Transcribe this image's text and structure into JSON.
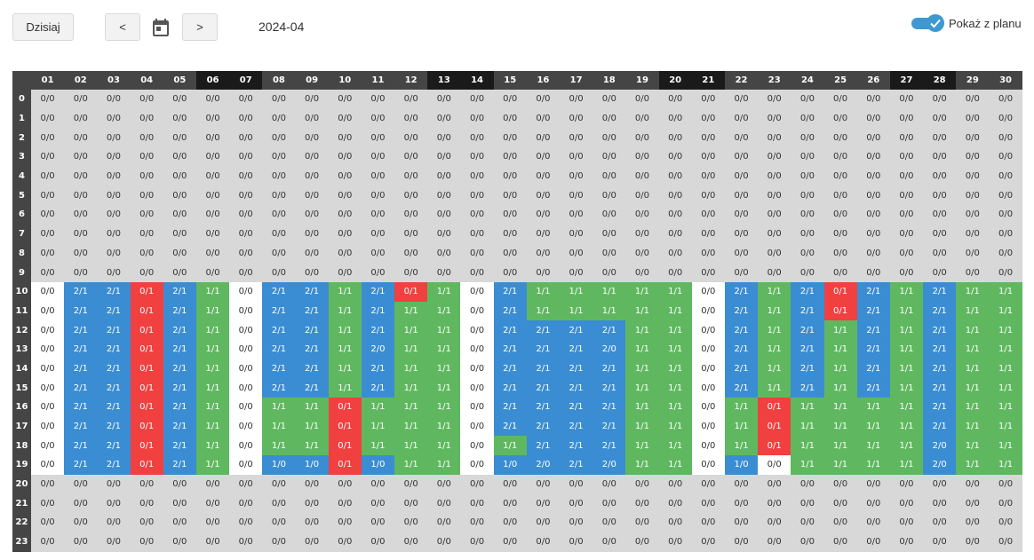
{
  "toolbar": {
    "today_label": "Dzisiaj",
    "prev_label": "<",
    "next_label": ">",
    "calendar_icon": "calendar-icon",
    "month": "2024-04",
    "show_plan_label": "Pokaż z planu",
    "show_plan_checked": true
  },
  "colors": {
    "blue": "#3a8dd2",
    "green": "#5fb85f",
    "red": "#f04040",
    "gray": "#d8d8d8",
    "header": "#454545",
    "header_weekend": "#1a1a1a",
    "toggle": "#3d9ad1"
  },
  "grid": {
    "days": [
      "01",
      "02",
      "03",
      "04",
      "05",
      "06",
      "07",
      "08",
      "09",
      "10",
      "11",
      "12",
      "13",
      "14",
      "15",
      "16",
      "17",
      "18",
      "19",
      "20",
      "21",
      "22",
      "23",
      "24",
      "25",
      "26",
      "27",
      "28",
      "29",
      "30"
    ],
    "weekend_days": [
      "06",
      "07",
      "13",
      "14",
      "20",
      "21",
      "27",
      "28"
    ],
    "hours": [
      "0",
      "1",
      "2",
      "3",
      "4",
      "5",
      "6",
      "7",
      "8",
      "9",
      "10",
      "11",
      "12",
      "13",
      "14",
      "15",
      "16",
      "17",
      "18",
      "19",
      "20",
      "21",
      "22",
      "23"
    ],
    "default_value": "0/0",
    "active_rows": [
      {
        "hour": "10",
        "cells": [
          "0/0:w",
          "2/1:b",
          "2/1:b",
          "0/1:r",
          "2/1:b",
          "1/1:n",
          "0/0:w",
          "2/1:b",
          "2/1:b",
          "1/1:n",
          "2/1:b",
          "0/1:r",
          "1/1:n",
          "0/0:w",
          "2/1:b",
          "1/1:n",
          "1/1:n",
          "1/1:n",
          "1/1:n",
          "1/1:n",
          "0/0:w",
          "2/1:b",
          "1/1:n",
          "2/1:b",
          "0/1:r",
          "2/1:b",
          "1/1:n",
          "2/1:b",
          "1/1:n",
          "1/1:n"
        ]
      },
      {
        "hour": "11",
        "cells": [
          "0/0:w",
          "2/1:b",
          "2/1:b",
          "0/1:r",
          "2/1:b",
          "1/1:n",
          "0/0:w",
          "2/1:b",
          "2/1:b",
          "1/1:n",
          "2/1:b",
          "1/1:n",
          "1/1:n",
          "0/0:w",
          "2/1:b",
          "1/1:n",
          "1/1:n",
          "1/1:n",
          "1/1:n",
          "1/1:n",
          "0/0:w",
          "2/1:b",
          "1/1:n",
          "2/1:b",
          "0/1:r",
          "2/1:b",
          "1/1:n",
          "2/1:b",
          "1/1:n",
          "1/1:n"
        ]
      },
      {
        "hour": "12",
        "cells": [
          "0/0:w",
          "2/1:b",
          "2/1:b",
          "0/1:r",
          "2/1:b",
          "1/1:n",
          "0/0:w",
          "2/1:b",
          "2/1:b",
          "1/1:n",
          "2/1:b",
          "1/1:n",
          "1/1:n",
          "0/0:w",
          "2/1:b",
          "2/1:b",
          "2/1:b",
          "2/1:b",
          "1/1:n",
          "1/1:n",
          "0/0:w",
          "2/1:b",
          "1/1:n",
          "2/1:b",
          "1/1:n",
          "2/1:b",
          "1/1:n",
          "2/1:b",
          "1/1:n",
          "1/1:n"
        ]
      },
      {
        "hour": "13",
        "cells": [
          "0/0:w",
          "2/1:b",
          "2/1:b",
          "0/1:r",
          "2/1:b",
          "1/1:n",
          "0/0:w",
          "2/1:b",
          "2/1:b",
          "1/1:n",
          "2/0:b",
          "1/1:n",
          "1/1:n",
          "0/0:w",
          "2/1:b",
          "2/1:b",
          "2/1:b",
          "2/0:b",
          "1/1:n",
          "1/1:n",
          "0/0:w",
          "2/1:b",
          "1/1:n",
          "2/1:b",
          "1/1:n",
          "2/1:b",
          "1/1:n",
          "2/1:b",
          "1/1:n",
          "1/1:n"
        ]
      },
      {
        "hour": "14",
        "cells": [
          "0/0:w",
          "2/1:b",
          "2/1:b",
          "0/1:r",
          "2/1:b",
          "1/1:n",
          "0/0:w",
          "2/1:b",
          "2/1:b",
          "1/1:n",
          "2/1:b",
          "1/1:n",
          "1/1:n",
          "0/0:w",
          "2/1:b",
          "2/1:b",
          "2/1:b",
          "2/1:b",
          "1/1:n",
          "1/1:n",
          "0/0:w",
          "2/1:b",
          "1/1:n",
          "2/1:b",
          "1/1:n",
          "2/1:b",
          "1/1:n",
          "2/1:b",
          "1/1:n",
          "1/1:n"
        ]
      },
      {
        "hour": "15",
        "cells": [
          "0/0:w",
          "2/1:b",
          "2/1:b",
          "0/1:r",
          "2/1:b",
          "1/1:n",
          "0/0:w",
          "2/1:b",
          "2/1:b",
          "1/1:n",
          "2/1:b",
          "1/1:n",
          "1/1:n",
          "0/0:w",
          "2/1:b",
          "2/1:b",
          "2/1:b",
          "2/1:b",
          "1/1:n",
          "1/1:n",
          "0/0:w",
          "2/1:b",
          "1/1:n",
          "2/1:b",
          "1/1:n",
          "2/1:b",
          "1/1:n",
          "2/1:b",
          "1/1:n",
          "1/1:n"
        ]
      },
      {
        "hour": "16",
        "cells": [
          "0/0:w",
          "2/1:b",
          "2/1:b",
          "0/1:r",
          "2/1:b",
          "1/1:n",
          "0/0:w",
          "1/1:n",
          "1/1:n",
          "0/1:r",
          "1/1:n",
          "1/1:n",
          "1/1:n",
          "0/0:w",
          "2/1:b",
          "2/1:b",
          "2/1:b",
          "2/1:b",
          "1/1:n",
          "1/1:n",
          "0/0:w",
          "1/1:n",
          "0/1:r",
          "1/1:n",
          "1/1:n",
          "1/1:n",
          "1/1:n",
          "2/1:b",
          "1/1:n",
          "1/1:n"
        ]
      },
      {
        "hour": "17",
        "cells": [
          "0/0:w",
          "2/1:b",
          "2/1:b",
          "0/1:r",
          "2/1:b",
          "1/1:n",
          "0/0:w",
          "1/1:n",
          "1/1:n",
          "0/1:r",
          "1/1:n",
          "1/1:n",
          "1/1:n",
          "0/0:w",
          "2/1:b",
          "2/1:b",
          "2/1:b",
          "2/1:b",
          "1/1:n",
          "1/1:n",
          "0/0:w",
          "1/1:n",
          "0/1:r",
          "1/1:n",
          "1/1:n",
          "1/1:n",
          "1/1:n",
          "2/1:b",
          "1/1:n",
          "1/1:n"
        ]
      },
      {
        "hour": "18",
        "cells": [
          "0/0:w",
          "2/1:b",
          "2/1:b",
          "0/1:r",
          "2/1:b",
          "1/1:n",
          "0/0:w",
          "1/1:n",
          "1/1:n",
          "0/1:r",
          "1/1:n",
          "1/1:n",
          "1/1:n",
          "0/0:w",
          "1/1:n",
          "2/1:b",
          "2/1:b",
          "2/1:b",
          "1/1:n",
          "1/1:n",
          "0/0:w",
          "1/1:n",
          "0/1:r",
          "1/1:n",
          "1/1:n",
          "1/1:n",
          "1/1:n",
          "2/0:b",
          "1/1:n",
          "1/1:n"
        ]
      },
      {
        "hour": "19",
        "cells": [
          "0/0:w",
          "2/1:b",
          "2/1:b",
          "0/1:r",
          "2/1:b",
          "1/1:n",
          "0/0:w",
          "1/0:b",
          "1/0:b",
          "0/1:r",
          "1/0:b",
          "1/1:n",
          "1/1:n",
          "0/0:w",
          "1/0:b",
          "2/0:b",
          "2/1:b",
          "2/0:b",
          "1/1:n",
          "1/1:n",
          "0/0:w",
          "1/0:b",
          "0/0:w",
          "1/1:n",
          "1/1:n",
          "1/1:n",
          "1/1:n",
          "2/0:b",
          "1/1:n",
          "1/1:n"
        ]
      }
    ]
  }
}
